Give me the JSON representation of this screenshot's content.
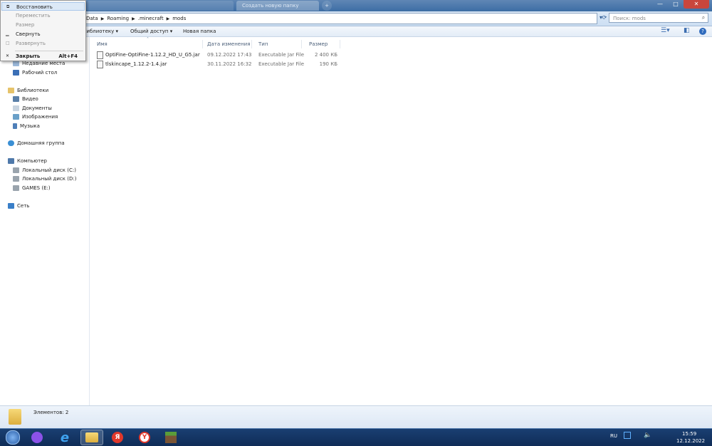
{
  "window": {
    "tabs": [
      "",
      "Создать новую папку"
    ],
    "controls": {
      "minimize": "—",
      "maximize": "□",
      "close": "✕"
    }
  },
  "address": {
    "segments": [
      "Data",
      "Roaming",
      ".minecraft",
      "mods"
    ],
    "search_placeholder": "Поиск: mods"
  },
  "toolbar": {
    "library": "библиотеку",
    "share": "Общий доступ",
    "new_folder": "Новая папка"
  },
  "nav": {
    "recent": "Недавние места",
    "desktop": "Рабочий стол",
    "libraries": "Библиотеки",
    "video": "Видео",
    "documents": "Документы",
    "images": "Изображения",
    "music": "Музыка",
    "homegroup": "Домашняя группа",
    "computer": "Компьютер",
    "disk_c": "Локальный диск (C:)",
    "disk_d": "Локальный диск (D:)",
    "disk_e": "GAMES (E:)",
    "network": "Сеть"
  },
  "columns": {
    "name": "Имя",
    "date": "Дата изменения",
    "type": "Тип",
    "size": "Размер"
  },
  "files": [
    {
      "name": "OptiFine-OptiFine-1.12.2_HD_U_G5.jar",
      "date": "09.12.2022 17:43",
      "type": "Executable Jar File",
      "size": "2 400 КБ"
    },
    {
      "name": "tlskincape_1.12.2-1.4.jar",
      "date": "30.11.2022 16:32",
      "type": "Executable Jar File",
      "size": "190 КБ"
    }
  ],
  "status": {
    "count": "Элементов: 2"
  },
  "sysmenu": {
    "restore": "Восстановить",
    "move": "Переместить",
    "size": "Размер",
    "minimize": "Свернуть",
    "maximize": "Развернуть",
    "close": "Закрыть",
    "close_shortcut": "Alt+F4"
  },
  "taskbar": {
    "lang": "RU",
    "time": "15:59",
    "date": "12.12.2022",
    "yandex_letter": "Я",
    "browser_letter": "Y"
  },
  "colors": {
    "accent": "#3d6da4",
    "taskbar": "#0f2c57",
    "highlight": "#dce9f7"
  }
}
